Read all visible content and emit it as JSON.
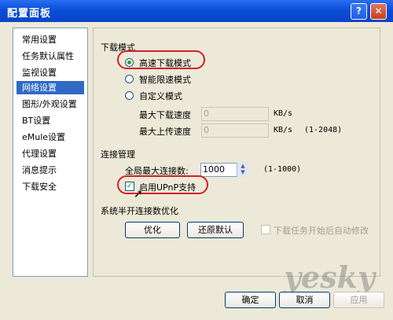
{
  "window": {
    "title": "配置面板"
  },
  "title_buttons": {
    "help": "?",
    "close": "✕"
  },
  "sidebar": {
    "items": [
      {
        "label": "常用设置"
      },
      {
        "label": "任务默认属性"
      },
      {
        "label": "监视设置"
      },
      {
        "label": "网络设置",
        "selected": true
      },
      {
        "label": "图形/外观设置"
      },
      {
        "label": "BT设置"
      },
      {
        "label": "eMule设置"
      },
      {
        "label": "代理设置"
      },
      {
        "label": "消息提示"
      },
      {
        "label": "下载安全"
      }
    ]
  },
  "download_mode": {
    "heading": "下载模式",
    "options": [
      "高速下载模式",
      "智能限速模式",
      "自定义模式"
    ],
    "selected_option": "高速下载模式",
    "max_download_label": "最大下载速度",
    "max_download_value": "0",
    "max_download_unit": "KB/s",
    "max_upload_label": "最大上传速度",
    "max_upload_value": "0",
    "max_upload_unit": "KB/s",
    "max_upload_range": "(1-2048)"
  },
  "connection": {
    "heading": "连接管理",
    "max_conn_label": "全局最大连接数:",
    "max_conn_value": "1000",
    "max_conn_range": "(1-1000)",
    "upnp_label": "启用UPnP支持",
    "upnp_checked": true
  },
  "half_open": {
    "heading": "系统半开连接数优化",
    "optimize_button": "优化",
    "restore_button": "还原默认",
    "auto_modify_label": "下载任务开始后自动修改",
    "auto_modify_checked": false
  },
  "footer": {
    "ok_button": "确定",
    "cancel_button": "取消",
    "apply_button": "应用"
  },
  "watermark": "yesky",
  "colors": {
    "titlebar": "#0a4fd8",
    "selection": "#316ac5",
    "highlight_ring": "#d41e2a"
  }
}
